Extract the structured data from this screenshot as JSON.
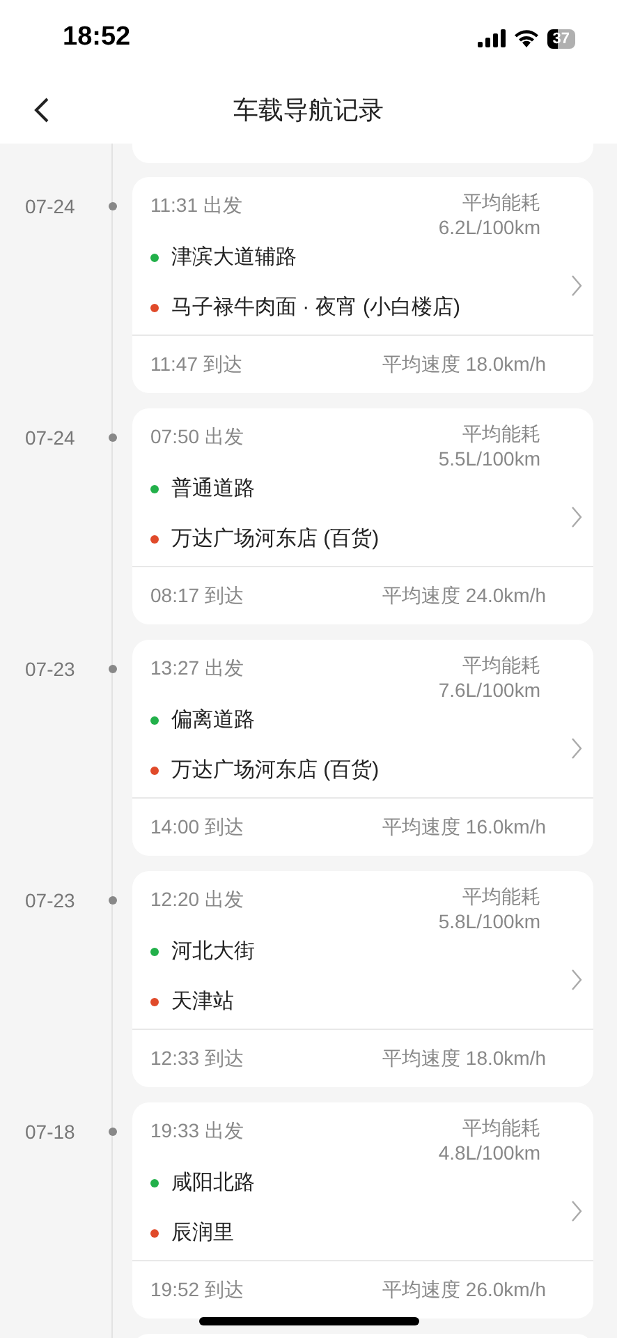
{
  "status_bar": {
    "time": "18:52",
    "battery": "37"
  },
  "nav": {
    "title": "车载导航记录"
  },
  "trips": [
    {
      "date": "07-24",
      "depart": "11:31 出发",
      "energy_label": "平均能耗",
      "energy": "6.2L/100km",
      "start": "津滨大道辅路",
      "end": "马子禄牛肉面 · 夜宵 (小白楼店)",
      "arrive": "11:47 到达",
      "speed": "平均速度 18.0km/h"
    },
    {
      "date": "07-24",
      "depart": "07:50 出发",
      "energy_label": "平均能耗",
      "energy": "5.5L/100km",
      "start": "普通道路",
      "end": "万达广场河东店 (百货)",
      "arrive": "08:17 到达",
      "speed": "平均速度 24.0km/h"
    },
    {
      "date": "07-23",
      "depart": "13:27 出发",
      "energy_label": "平均能耗",
      "energy": "7.6L/100km",
      "start": "偏离道路",
      "end": "万达广场河东店 (百货)",
      "arrive": "14:00 到达",
      "speed": "平均速度 16.0km/h"
    },
    {
      "date": "07-23",
      "depart": "12:20 出发",
      "energy_label": "平均能耗",
      "energy": "5.8L/100km",
      "start": "河北大街",
      "end": "天津站",
      "arrive": "12:33 到达",
      "speed": "平均速度 18.0km/h"
    },
    {
      "date": "07-18",
      "depart": "19:33 出发",
      "energy_label": "平均能耗",
      "energy": "4.8L/100km",
      "start": "咸阳北路",
      "end": "辰润里",
      "arrive": "19:52 到达",
      "speed": "平均速度 26.0km/h"
    }
  ]
}
